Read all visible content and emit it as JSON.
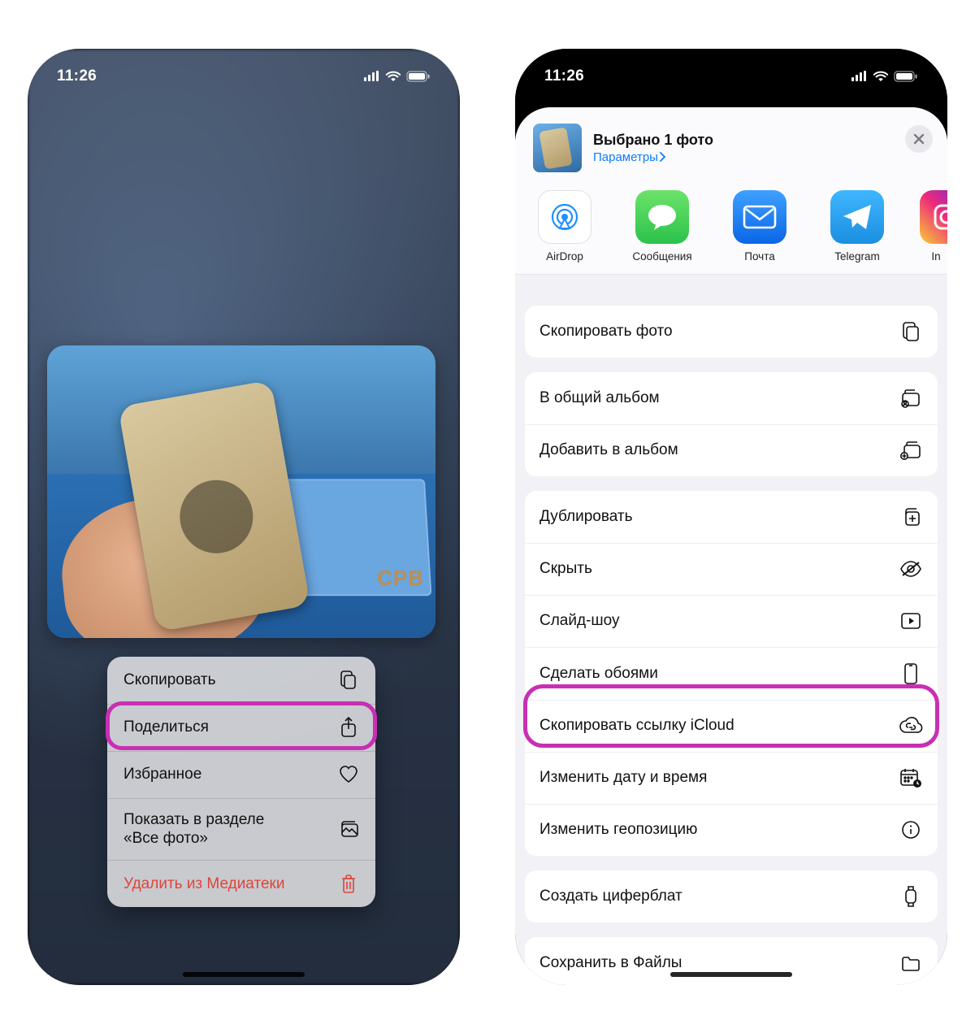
{
  "status": {
    "time": "11:26"
  },
  "left": {
    "thumb_logo": "CPB",
    "menu": {
      "copy": "Скопировать",
      "share": "Поделиться",
      "favorite": "Избранное",
      "show_all_l1": "Показать в разделе",
      "show_all_l2": "«Все фото»",
      "delete": "Удалить из Медиатеки"
    }
  },
  "right": {
    "header": {
      "title": "Выбрано 1 фото",
      "options": "Параметры"
    },
    "apps": {
      "airdrop": "AirDrop",
      "messages": "Сообщения",
      "mail": "Почта",
      "telegram": "Telegram",
      "instagram": "In"
    },
    "actions": {
      "copy_photo": "Скопировать фото",
      "shared_album": "В общий альбом",
      "add_album": "Добавить в альбом",
      "duplicate": "Дублировать",
      "hide": "Скрыть",
      "slideshow": "Слайд-шоу",
      "wallpaper": "Сделать обоями",
      "icloud_link": "Скопировать ссылку iCloud",
      "edit_date": "Изменить дату и время",
      "edit_location": "Изменить геопозицию",
      "watch_face": "Создать циферблат",
      "save_files": "Сохранить в Файлы"
    }
  }
}
